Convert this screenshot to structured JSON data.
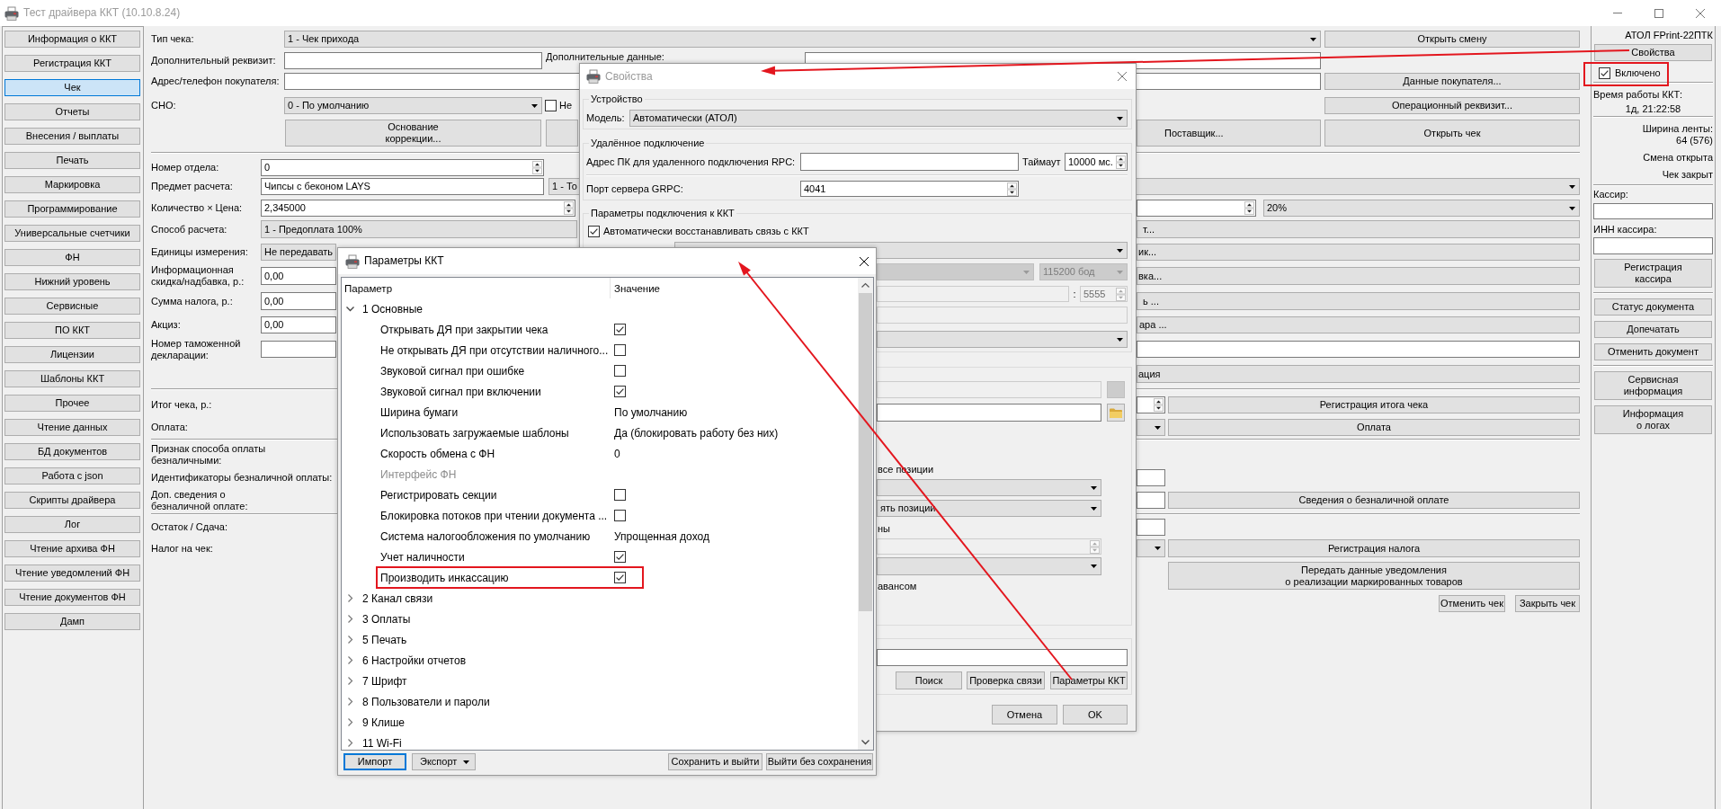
{
  "window": {
    "title": "Тест драйвера ККТ (10.10.8.24)",
    "active": false
  },
  "sidebar": {
    "items": [
      {
        "label": "Информация о ККТ",
        "selected": false
      },
      {
        "label": "Регистрация ККТ",
        "selected": false
      },
      {
        "label": "Чек",
        "selected": true
      },
      {
        "label": "Отчеты",
        "selected": false
      },
      {
        "label": "Внесения / выплаты",
        "selected": false
      },
      {
        "label": "Печать",
        "selected": false
      },
      {
        "label": "Маркировка",
        "selected": false
      },
      {
        "label": "Программирование",
        "selected": false
      },
      {
        "label": "Универсальные счетчики",
        "selected": false
      },
      {
        "label": "ФН",
        "selected": false
      },
      {
        "label": "Нижний уровень",
        "selected": false
      },
      {
        "label": "Сервисные",
        "selected": false
      },
      {
        "label": "ПО ККТ",
        "selected": false
      },
      {
        "label": "Лицензии",
        "selected": false
      },
      {
        "label": "Шаблоны ККТ",
        "selected": false
      },
      {
        "label": "Прочее",
        "selected": false
      },
      {
        "label": "Чтение данных",
        "selected": false
      },
      {
        "label": "БД документов",
        "selected": false
      },
      {
        "label": "Работа с json",
        "selected": false
      },
      {
        "label": "Скрипты драйвера",
        "selected": false
      },
      {
        "label": "Лог",
        "selected": false
      },
      {
        "label": "Чтение архива ФН",
        "selected": false
      },
      {
        "label": "Чтение уведомлений ФН",
        "selected": false
      },
      {
        "label": "Чтение документов ФН",
        "selected": false
      },
      {
        "label": "Дамп",
        "selected": false
      }
    ]
  },
  "receipt": {
    "receipt_type": {
      "label": "Тип чека:",
      "value": "1 - Чек прихода"
    },
    "additional_requisite": {
      "label": "Дополнительный реквизит:"
    },
    "additional_data": {
      "label": "Дополнительные данные:"
    },
    "buyer_contact": {
      "label": "Адрес/телефон покупателя:"
    },
    "tax_system": {
      "label": "СНО:",
      "value": "0 - По умолчанию"
    },
    "tax_system_option": {
      "label": "Не",
      "checked": false
    },
    "correction_basis_button": "Основание\nкоррекции...",
    "supplier_button": "Поставщик...",
    "open_shift_button": "Открыть смену",
    "buyer_data_button": "Данные покупателя...",
    "operational_requisite_button": "Операционный реквизит...",
    "open_receipt_button": "Открыть чек",
    "department": {
      "label": "Номер отдела:",
      "value": "0"
    },
    "item": {
      "label": "Предмет расчета:",
      "value": "Чипсы с беконом LAYS",
      "item_type": "1 - То"
    },
    "quantity_price": {
      "label": "Количество × Цена:",
      "value": "2,345000",
      "vat": "20%"
    },
    "payment_method": {
      "label": "Способ расчета:",
      "value": "1 - Предоплата 100%",
      "side_button": "т..."
    },
    "unit": {
      "label": "Единицы измерения:",
      "value": "Не передавать",
      "side_button": "ик..."
    },
    "info_discount": {
      "label": "Информационная\nскидка/надбавка, р.:",
      "value": "0,00",
      "side_button": "вка..."
    },
    "tax_amount": {
      "label": "Сумма налога, р.:",
      "value": "0,00",
      "side_button": "ь ..."
    },
    "excise": {
      "label": "Акциз:",
      "value": "0,00",
      "side_button": "ара ..."
    },
    "customs_declaration": {
      "label": "Номер таможенной\nдекларации:"
    },
    "extra_button": "ация",
    "total": {
      "label": "Итог чека, р.:",
      "button": "Регистрация итога чека"
    },
    "payment": {
      "label": "Оплата:",
      "button": "Оплата"
    },
    "cashless_sign": {
      "label": "Признак способа оплаты\nбезналичными:"
    },
    "cashless_ids": {
      "label": "Идентификаторы безналичной оплаты:"
    },
    "cashless_info": {
      "label": "Доп. сведения о\nбезналичной оплате:",
      "button": "Сведения о безналичной оплате"
    },
    "change": {
      "label": "Остаток / Сдача:"
    },
    "receipt_tax": {
      "label": "Налог на чек:",
      "button": "Регистрация налога"
    },
    "marking_notice_button": "Передать данные уведомления\nо реализации маркированных товаров",
    "cancel_receipt_button": "Отменить чек",
    "close_receipt_button": "Закрыть чек"
  },
  "device_panel": {
    "model": "АТОЛ FPrint-22ПТК",
    "properties_button": "Свойства",
    "enabled": {
      "label": "Включено",
      "checked": true
    },
    "uptime_label": "Время работы ККТ:",
    "uptime": "1д, 21:22:58",
    "tape_width_label": "Ширина ленты:",
    "tape_width": "64 (576)",
    "shift_status": "Смена открыта",
    "receipt_status": "Чек закрыт",
    "cashier_label": "Кассир:",
    "cashier_inn_label": "ИНН кассира:",
    "button_groups": [
      [
        "Регистрация\nкассира"
      ],
      [
        "Статус документа",
        "Допечатать",
        "Отменить документ"
      ],
      [
        "Сервисная\nинформация",
        "Информация\nо логах"
      ]
    ]
  },
  "properties_dialog": {
    "title": "Свойства",
    "active": false,
    "device_group": {
      "title": "Устройство",
      "model_label": "Модель:",
      "model": "Автоматически (АТОЛ)"
    },
    "remote_group": {
      "title": "Удалённое подключение",
      "address_label": "Адрес ПК для удаленного подключения RPC:",
      "timeout_label": "Таймаут",
      "timeout": "10000 мс.",
      "port_label": "Порт сервера GRPC:",
      "port": "4041"
    },
    "connection_group": {
      "title": "Параметры подключения к ККТ",
      "auto_reconnect": {
        "label": "Автоматически восстанавливать связь с ККТ",
        "checked": true
      },
      "select_1": {
        "disabled": false
      },
      "select_2": {
        "disabled": true
      },
      "baud_rate": {
        "value": "115200 бод",
        "disabled": true
      },
      "field_1": {
        "disabled": true
      },
      "colon": ":",
      "spin_1": {
        "value": "5555",
        "disabled": true
      },
      "field_2": {
        "disabled": true
      },
      "select_3": {
        "disabled": false
      }
    },
    "options_group": {
      "field_1": {
        "disabled": true
      },
      "button_1": {
        "disabled": true
      },
      "field_2": {
        "disabled": false
      },
      "browse_button": {
        "disabled": false
      },
      "text_1": "все позиции",
      "select_1": {
        "disabled": false
      },
      "select_2": {
        "value": "ять позиции",
        "disabled": false
      },
      "text_2": "ны",
      "spin_1": {
        "disabled": true
      },
      "select_3": {
        "disabled": false
      },
      "text_3": "авансом"
    },
    "search_group": {
      "buttons": [
        "Поиск",
        "Проверка связи",
        "Параметры ККТ"
      ]
    },
    "buttons": [
      "Отмена",
      "OK"
    ]
  },
  "params_dialog": {
    "title": "Параметры ККТ",
    "active": true,
    "columns": [
      "Параметр",
      "Значение"
    ],
    "tree": [
      {
        "label": "1 Основные",
        "expanded": true,
        "children": [
          {
            "label": "Открывать ДЯ при закрытии чека",
            "kind": "checkbox",
            "checked": true,
            "disabled": false
          },
          {
            "label": "Не открывать ДЯ при отсутствии наличного...",
            "kind": "checkbox",
            "checked": false,
            "disabled": false
          },
          {
            "label": "Звуковой сигнал при ошибке",
            "kind": "checkbox",
            "checked": false,
            "disabled": false
          },
          {
            "label": "Звуковой сигнал при включении",
            "kind": "checkbox",
            "checked": true,
            "disabled": false
          },
          {
            "label": "Ширина бумаги",
            "kind": "text",
            "value": "По умолчанию",
            "disabled": false
          },
          {
            "label": "Использовать загружаемые шаблоны",
            "kind": "text",
            "value": "Да (блокировать работу без них)",
            "disabled": false
          },
          {
            "label": "Скорость обмена с ФН",
            "kind": "text",
            "value": "0",
            "disabled": false
          },
          {
            "label": "Интерфейс ФН",
            "kind": "text",
            "disabled": true
          },
          {
            "label": "Регистрировать секции",
            "kind": "checkbox",
            "checked": false,
            "disabled": false
          },
          {
            "label": "Блокировка потоков при чтении документа ...",
            "kind": "checkbox",
            "checked": false,
            "disabled": false
          },
          {
            "label": "Система налогообложения по умолчанию",
            "kind": "text",
            "value": "Упрощенная доход",
            "disabled": false
          },
          {
            "label": "Учет наличности",
            "kind": "checkbox",
            "checked": true,
            "disabled": false
          },
          {
            "label": "Производить инкассацию",
            "kind": "checkbox",
            "checked": true,
            "disabled": false
          }
        ]
      },
      {
        "label": "2 Канал связи",
        "expanded": false
      },
      {
        "label": "3 Оплаты",
        "expanded": false
      },
      {
        "label": "5 Печать",
        "expanded": false
      },
      {
        "label": "6 Настройки отчетов",
        "expanded": false
      },
      {
        "label": "7 Шрифт",
        "expanded": false
      },
      {
        "label": "8 Пользователи и пароли",
        "expanded": false
      },
      {
        "label": "9 Клише",
        "expanded": false
      },
      {
        "label": "11 Wi-Fi",
        "expanded": false
      }
    ],
    "left_buttons": [
      {
        "label": "Импорт",
        "kind": "button",
        "default": true
      },
      {
        "label": "Экспорт",
        "kind": "menu",
        "default": false
      }
    ],
    "right_buttons": [
      "Сохранить и выйти",
      "Выйти без сохранения"
    ]
  }
}
